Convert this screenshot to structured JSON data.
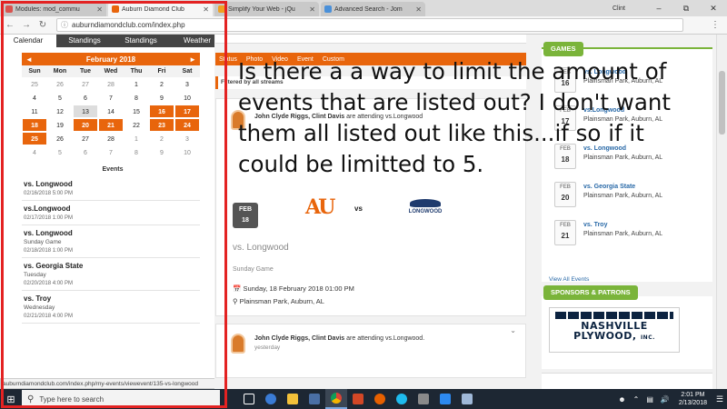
{
  "browser": {
    "tabs": [
      {
        "title": "Modules: mod_commu",
        "color": "#d9534f",
        "active": false
      },
      {
        "title": "Auburn Diamond Club",
        "color": "#e8650c",
        "active": true
      },
      {
        "title": "Simplify Your Web - jQu",
        "color": "#f0a020",
        "active": false
      },
      {
        "title": "Advanced Search - Jom",
        "color": "#4a90d9",
        "active": false
      }
    ],
    "user": "Clint",
    "url": "auburndiamondclub.com/index.php",
    "status_url": "auburndiamondclub.com/index.php/my-events/viewevent/135-vs-longwood"
  },
  "calendar": {
    "tabs": [
      "Calendar",
      "Standings",
      "Standings",
      "Weather"
    ],
    "month_label": "February 2018",
    "prev": "◄",
    "next": "►",
    "dow": [
      "Sun",
      "Mon",
      "Tue",
      "Wed",
      "Thu",
      "Fri",
      "Sat"
    ],
    "days": [
      {
        "d": "25",
        "s": "dim"
      },
      {
        "d": "26",
        "s": "dim"
      },
      {
        "d": "27",
        "s": "dim"
      },
      {
        "d": "28",
        "s": "dim"
      },
      {
        "d": "1",
        "s": ""
      },
      {
        "d": "2",
        "s": ""
      },
      {
        "d": "3",
        "s": ""
      },
      {
        "d": "4",
        "s": ""
      },
      {
        "d": "5",
        "s": ""
      },
      {
        "d": "6",
        "s": ""
      },
      {
        "d": "7",
        "s": ""
      },
      {
        "d": "8",
        "s": ""
      },
      {
        "d": "9",
        "s": ""
      },
      {
        "d": "10",
        "s": ""
      },
      {
        "d": "11",
        "s": ""
      },
      {
        "d": "12",
        "s": ""
      },
      {
        "d": "13",
        "s": "today"
      },
      {
        "d": "14",
        "s": ""
      },
      {
        "d": "15",
        "s": ""
      },
      {
        "d": "16",
        "s": "ev"
      },
      {
        "d": "17",
        "s": "ev"
      },
      {
        "d": "18",
        "s": "ev"
      },
      {
        "d": "19",
        "s": ""
      },
      {
        "d": "20",
        "s": "ev"
      },
      {
        "d": "21",
        "s": "ev"
      },
      {
        "d": "22",
        "s": ""
      },
      {
        "d": "23",
        "s": "ev"
      },
      {
        "d": "24",
        "s": "ev"
      },
      {
        "d": "25",
        "s": "ev"
      },
      {
        "d": "26",
        "s": ""
      },
      {
        "d": "27",
        "s": ""
      },
      {
        "d": "28",
        "s": ""
      },
      {
        "d": "1",
        "s": "dim"
      },
      {
        "d": "2",
        "s": "dim"
      },
      {
        "d": "3",
        "s": "dim"
      },
      {
        "d": "4",
        "s": "dim"
      },
      {
        "d": "5",
        "s": "dim"
      },
      {
        "d": "6",
        "s": "dim"
      },
      {
        "d": "7",
        "s": "dim"
      },
      {
        "d": "8",
        "s": "dim"
      },
      {
        "d": "9",
        "s": "dim"
      },
      {
        "d": "10",
        "s": "dim"
      }
    ],
    "events_title": "Events",
    "events": [
      {
        "name": "vs. Longwood",
        "sub": "",
        "date": "02/16/2018 5:00 PM"
      },
      {
        "name": "vs.Longwood",
        "sub": "",
        "date": "02/17/2018 1:00 PM"
      },
      {
        "name": "vs. Longwood",
        "sub": "Sunday Game",
        "date": "02/18/2018 1:00 PM"
      },
      {
        "name": "vs. Georgia State",
        "sub": "Tuesday",
        "date": "02/20/2018 4:00 PM"
      },
      {
        "name": "vs. Troy",
        "sub": "Wednesday",
        "date": "02/21/2018 4:00 PM"
      }
    ]
  },
  "feed": {
    "tabs": [
      "Status",
      "Photo",
      "Video",
      "Event",
      "Custom"
    ],
    "filter": "Filtered by all streams",
    "post1": {
      "who": "John Clyde Riggs, Clint Davis",
      "action": "are attending vs.Longwood",
      "home": "AU",
      "vs": "vs",
      "away": "LONGWOOD",
      "badge_month": "FEB",
      "badge_day": "18",
      "title": "vs. Longwood",
      "type": "Sunday Game",
      "when": "Sunday, 18 February 2018 01:00 PM",
      "where": "Plainsman Park, Auburn, AL"
    },
    "post2": {
      "who": "John Clyde Riggs, Clint Davis",
      "action": "are attending vs.Longwood.",
      "ago": "yesterday"
    }
  },
  "sidebar": {
    "games_label": "GAMES",
    "games": [
      {
        "month": "FEB",
        "day": "16",
        "name": "vs. Longwood",
        "place": "Plainsman Park, Auburn, AL"
      },
      {
        "month": "FEB",
        "day": "17",
        "name": "vs.Longwood",
        "place": "Plainsman Park, Auburn, AL"
      },
      {
        "month": "FEB",
        "day": "18",
        "name": "vs. Longwood",
        "place": "Plainsman Park, Auburn, AL"
      },
      {
        "month": "FEB",
        "day": "20",
        "name": "vs. Georgia State",
        "place": "Plainsman Park, Auburn, AL"
      },
      {
        "month": "FEB",
        "day": "21",
        "name": "vs. Troy",
        "place": "Plainsman Park, Auburn, AL"
      }
    ],
    "view_all": "View All Events",
    "sponsors_label": "SPONSORS & PATRONS",
    "sponsor_line1": "NASHVILLE",
    "sponsor_line2": "PLYWOOD",
    "sponsor_suffix": "INC."
  },
  "overlay_text": "Is there a a way to limit the amount of events that are listed out?  I don't want them all listed out like this...if so if it could be limitted to 5.",
  "taskbar": {
    "search_placeholder": "Type here to search",
    "time": "2:01 PM",
    "date": "2/13/2018"
  },
  "colors": {
    "accent": "#e8650c",
    "green": "#7ab43a",
    "highlight": "#e32222"
  }
}
